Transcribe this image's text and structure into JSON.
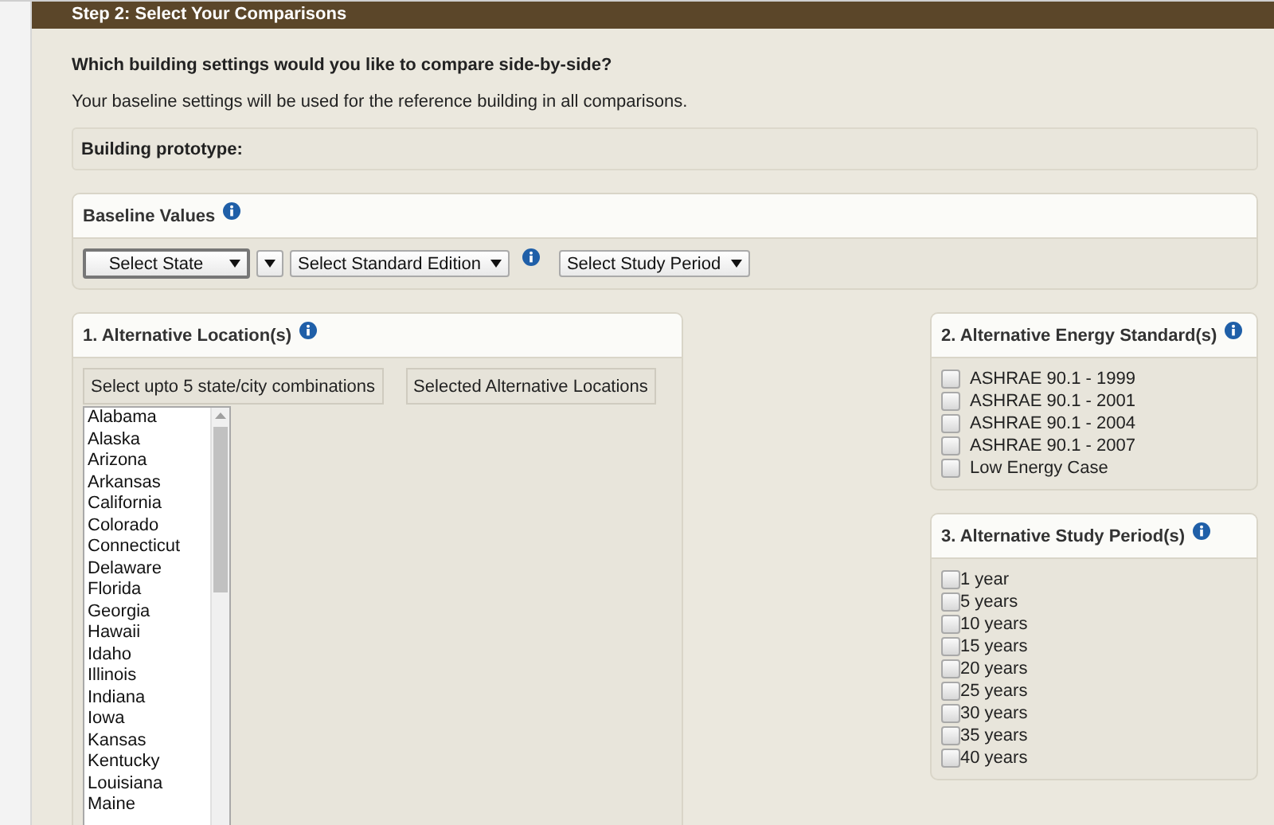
{
  "header": {
    "title": "Step 2: Select Your Comparisons"
  },
  "question": "Which building settings would you like to compare side-by-side?",
  "note": "Your baseline settings will be used for the reference building in all comparisons.",
  "prototype": {
    "label": "Building prototype:"
  },
  "baseline": {
    "title": "Baseline Values",
    "controls": [
      {
        "kind": "select",
        "value": "Select State",
        "focused": true
      },
      {
        "kind": "select",
        "focused": false
      },
      {
        "kind": "select",
        "value": "Select Standard Edition",
        "focused": false
      },
      {
        "kind": "info"
      },
      {
        "kind": "select",
        "value": "Select Study Period",
        "focused": false
      }
    ]
  },
  "locations": {
    "title": "1. Alternative Location(s)",
    "buttons": [
      "Select upto 5 state/city combinations",
      "Selected Alternative Locations"
    ],
    "states": [
      "Alabama",
      "Alaska",
      "Arizona",
      "Arkansas",
      "California",
      "Colorado",
      "Connecticut",
      "Delaware",
      "Florida",
      "Georgia",
      "Hawaii",
      "Idaho",
      "Illinois",
      "Indiana",
      "Iowa",
      "Kansas",
      "Kentucky",
      "Louisiana",
      "Maine"
    ]
  },
  "standards": {
    "title": "2. Alternative Energy Standard(s)",
    "options": [
      {
        "label": "ASHRAE 90.1 - 1999",
        "checked": false
      },
      {
        "label": "ASHRAE 90.1 - 2001",
        "checked": false
      },
      {
        "label": "ASHRAE 90.1 - 2004",
        "checked": false
      },
      {
        "label": "ASHRAE 90.1 - 2007",
        "checked": false
      },
      {
        "label": "Low Energy Case",
        "checked": false
      }
    ]
  },
  "periods": {
    "title": "3. Alternative Study Period(s)",
    "options": [
      {
        "label": "1 year",
        "checked": false
      },
      {
        "label": "5 years",
        "checked": false
      },
      {
        "label": "10 years",
        "checked": false
      },
      {
        "label": "15 years",
        "checked": false
      },
      {
        "label": "20 years",
        "checked": false
      },
      {
        "label": "25 years",
        "checked": false
      },
      {
        "label": "30 years",
        "checked": false
      },
      {
        "label": "35 years",
        "checked": false
      },
      {
        "label": "40 years",
        "checked": false
      }
    ]
  }
}
